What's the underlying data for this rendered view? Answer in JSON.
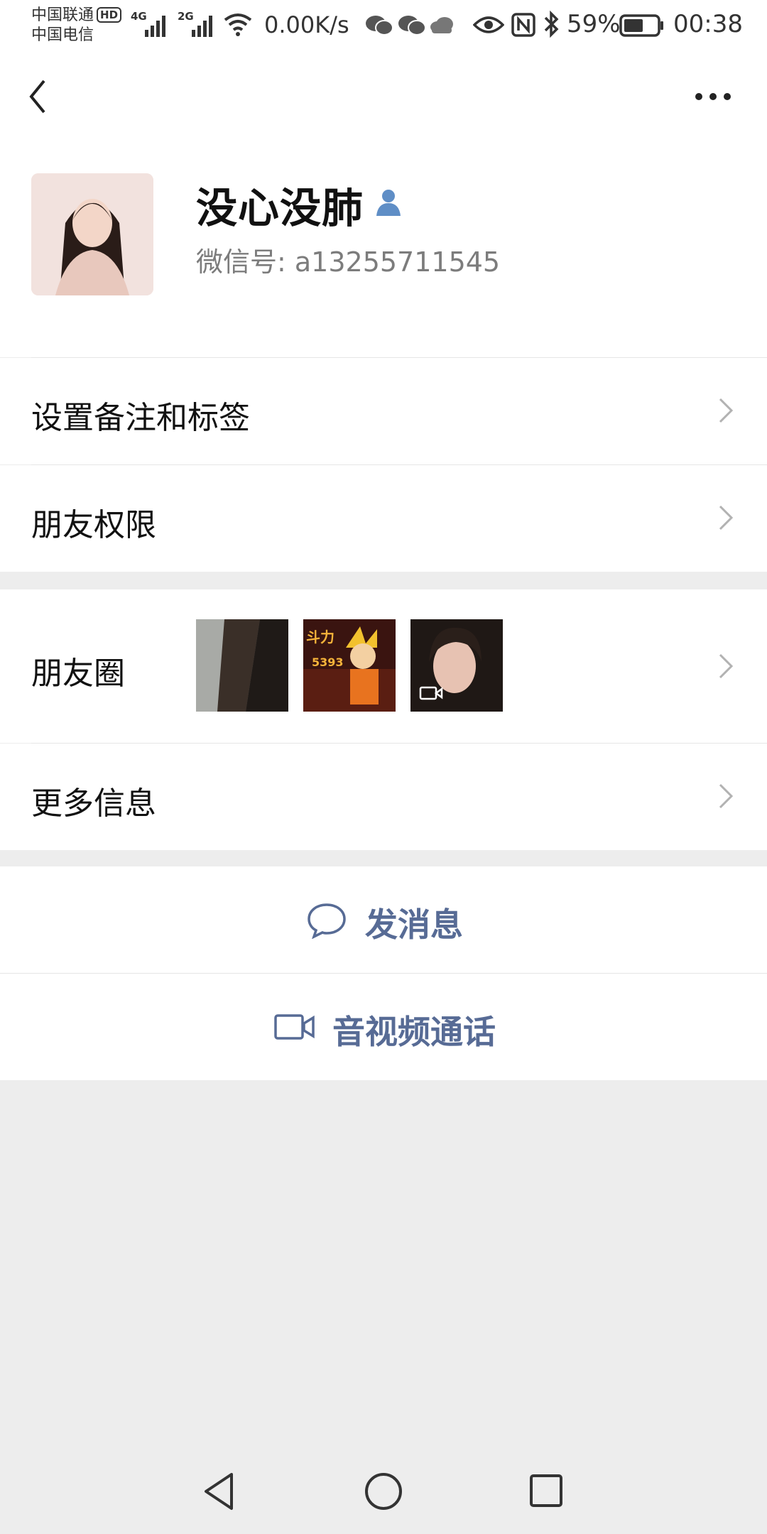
{
  "status_bar": {
    "carrier1": "中国联通",
    "hd_badge": "HD",
    "carrier2": "中国电信",
    "net1": "4G",
    "net2": "2G",
    "speed": "0.00K/s",
    "battery": "59%",
    "time": "00:38"
  },
  "profile": {
    "name": "没心没肺",
    "wechat_id": "微信号:  a13255711545"
  },
  "menu": {
    "remark": "设置备注和标签",
    "permission": "朋友权限",
    "moments": "朋友圈",
    "more_info": "更多信息"
  },
  "actions": {
    "send_message": "发消息",
    "video_call": "音视频通话"
  },
  "moments_thumbs": [
    {
      "name": "moment-photo-1"
    },
    {
      "name": "moment-photo-2",
      "text": "斗力 5393"
    },
    {
      "name": "moment-video-3"
    }
  ]
}
